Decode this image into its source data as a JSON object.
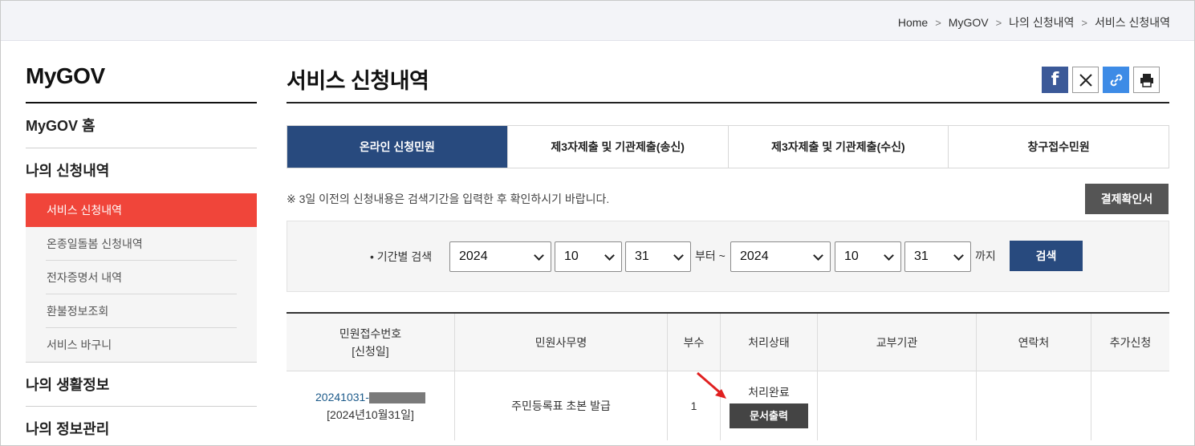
{
  "breadcrumb": [
    "Home",
    "MyGOV",
    "나의 신청내역",
    "서비스 신청내역"
  ],
  "sidebar": {
    "title": "MyGOV",
    "home": "MyGOV 홈",
    "section_applications": "나의 신청내역",
    "items": [
      "서비스 신청내역",
      "온종일돌봄 신청내역",
      "전자증명서 내역",
      "환불정보조회",
      "서비스 바구니"
    ],
    "section_life": "나의 생활정보",
    "section_info": "나의 정보관리"
  },
  "main": {
    "title": "서비스 신청내역",
    "tabs": [
      "온라인 신청민원",
      "제3자제출 및 기관제출(송신)",
      "제3자제출 및 기관제출(수신)",
      "창구접수민원"
    ],
    "notice": "※ 3일 이전의 신청내용은 검색기간을 입력한 후 확인하시기 바랍니다.",
    "confirm_button": "결제확인서",
    "search": {
      "label": "• 기간별 검색",
      "from_year": "2024",
      "from_month": "10",
      "from_day": "31",
      "from_text": "부터 ~",
      "to_year": "2024",
      "to_month": "10",
      "to_day": "31",
      "to_text": "까지",
      "button": "검색"
    },
    "table": {
      "headers": [
        "민원접수번호",
        "[신청일]",
        "민원사무명",
        "부수",
        "처리상태",
        "교부기관",
        "연락처",
        "추가신청"
      ],
      "row": {
        "receipt_no": "20241031-",
        "date": "[2024년10월31일]",
        "service": "주민등록표 초본 발급",
        "copies": "1",
        "status": "처리완료",
        "print_button": "문서출력"
      }
    }
  },
  "colors": {
    "accent_blue": "#284a7e",
    "accent_red": "#f0453a"
  },
  "icons": [
    "facebook-icon",
    "x-twitter-icon",
    "link-icon",
    "print-icon"
  ]
}
